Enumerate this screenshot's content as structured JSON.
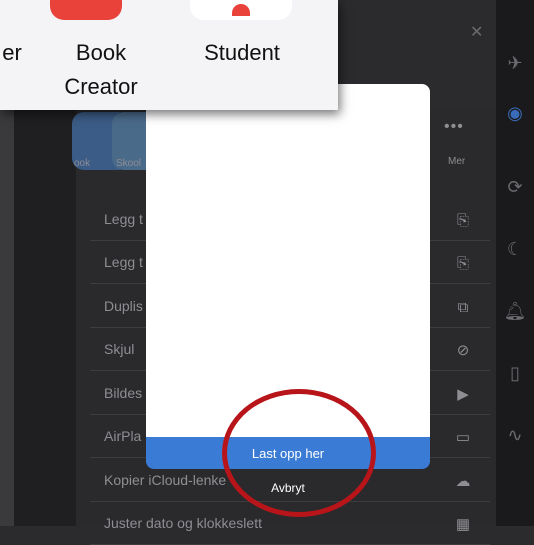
{
  "inset": {
    "items": [
      {
        "label": "er"
      },
      {
        "label": "Book\nCreator"
      },
      {
        "label": "Student"
      }
    ]
  },
  "sheet": {
    "apps": [
      {
        "label": "ook"
      },
      {
        "label": "Skool"
      }
    ],
    "more_label": "Mer",
    "actions": [
      {
        "label": "Legg t",
        "icon": "doc-add-icon"
      },
      {
        "label": "Legg t",
        "icon": "doc-add-icon"
      },
      {
        "label": "Duplis",
        "icon": "duplicate-icon"
      },
      {
        "label": "Skjul",
        "icon": "eye-slash-icon"
      },
      {
        "label": "Bildes",
        "icon": "slideshow-icon"
      },
      {
        "label": "AirPla",
        "icon": "airplay-icon"
      },
      {
        "label": "Kopier iCloud-lenke",
        "icon": "cloud-link-icon"
      },
      {
        "label": "Juster dato og klokkeslett",
        "icon": "calendar-icon"
      }
    ]
  },
  "dialog": {
    "header_glyph": "ooo",
    "upload_label": "Last opp her",
    "cancel_label": "Avbryt"
  },
  "colors": {
    "upload_button": "#3a7bd5",
    "annotation_circle": "#b8151b",
    "book_creator_icon": "#e8423b"
  }
}
